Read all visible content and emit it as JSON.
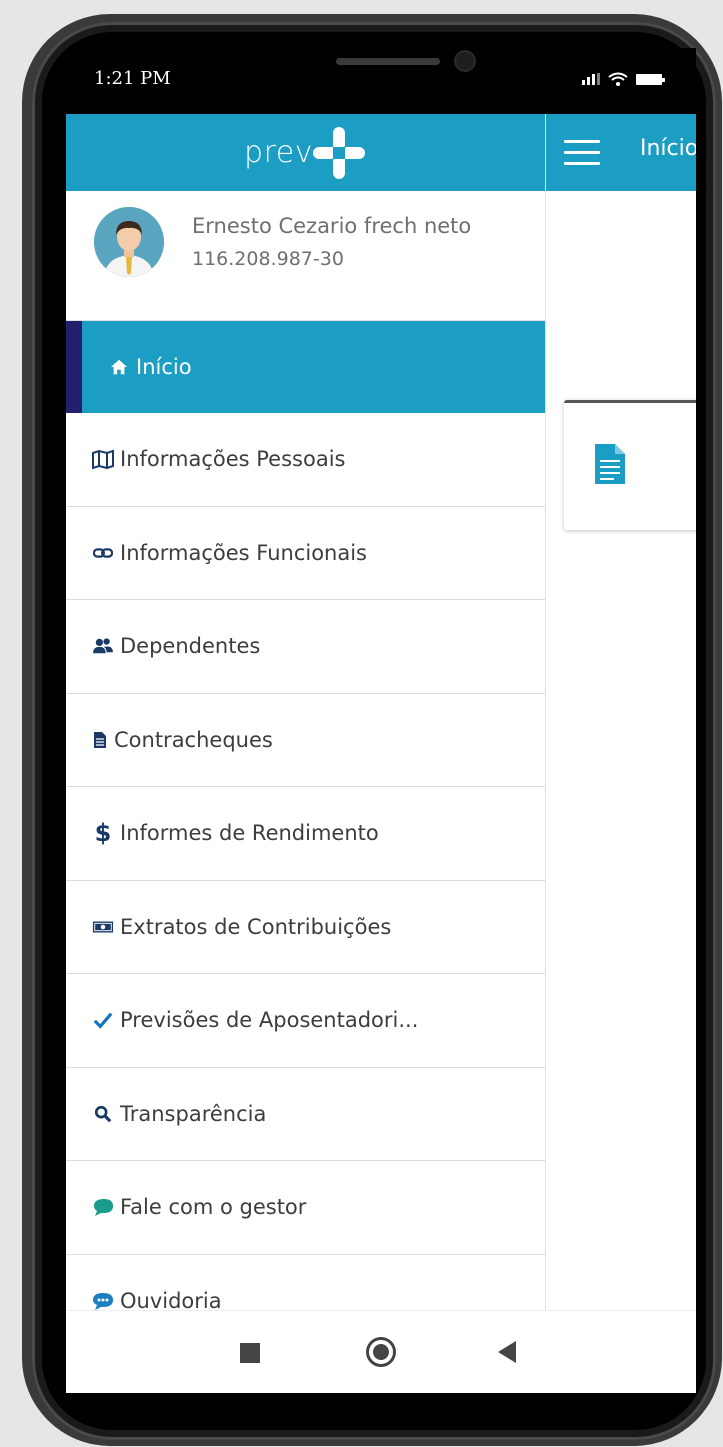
{
  "status_bar": {
    "time": "1:21 PM"
  },
  "drawer": {
    "logo_text": "prev",
    "profile": {
      "name": "Ernesto Cezario frech neto",
      "cpf": "116.208.987-30"
    },
    "menu": [
      {
        "label": "Início",
        "icon": "home-icon",
        "active": true
      },
      {
        "label": "Informações Pessoais",
        "icon": "map-icon"
      },
      {
        "label": "Informações Funcionais",
        "icon": "link-icon"
      },
      {
        "label": "Dependentes",
        "icon": "users-icon"
      },
      {
        "label": "Contracheques",
        "icon": "document-icon"
      },
      {
        "label": "Informes de Rendimento",
        "icon": "dollar-icon"
      },
      {
        "label": "Extratos de Contribuições",
        "icon": "money-icon"
      },
      {
        "label": "Previsões de Aposentadori...",
        "icon": "check-icon"
      },
      {
        "label": "Transparência",
        "icon": "search-icon"
      },
      {
        "label": "Fale com o gestor",
        "icon": "chat-icon"
      },
      {
        "label": "Ouvidoria",
        "icon": "comment-dots-icon"
      }
    ]
  },
  "content": {
    "appbar_title": "Início"
  },
  "colors": {
    "primary": "#1b9dc4",
    "active_indicator": "#23206b",
    "menu_text": "#3d3d3d",
    "profile_text": "#6f6f6f"
  }
}
